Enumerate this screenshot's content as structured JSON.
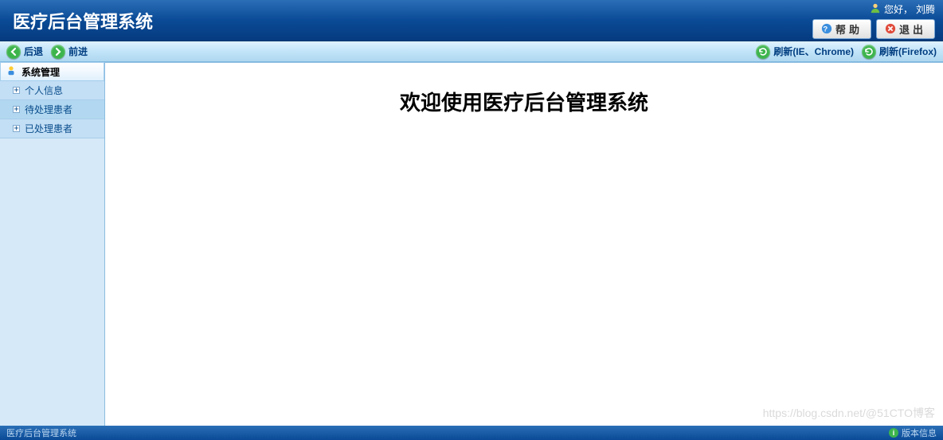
{
  "header": {
    "title": "医疗后台管理系统",
    "greeting_prefix": "您好，",
    "username": "刘腾",
    "help_label": "帮助",
    "exit_label": "退出"
  },
  "navbar": {
    "back_label": "后退",
    "forward_label": "前进",
    "refresh_ie_label": "刷新(IE、Chrome)",
    "refresh_ff_label": "刷新(Firefox)"
  },
  "sidebar": {
    "header_label": "系统管理",
    "items": [
      {
        "label": "个人信息"
      },
      {
        "label": "待处理患者"
      },
      {
        "label": "已处理患者"
      }
    ]
  },
  "main": {
    "welcome_text": "欢迎使用医疗后台管理系统"
  },
  "footer": {
    "left_text": "医疗后台管理系统",
    "right_text": "版本信息"
  },
  "watermark": "https://blog.csdn.net/@51CTO博客"
}
